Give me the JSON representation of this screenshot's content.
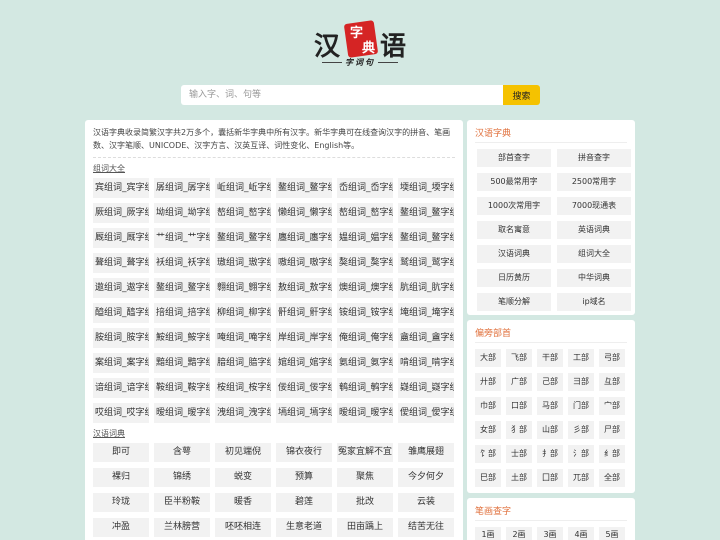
{
  "logo": {
    "char1": "汉",
    "seal1": "字",
    "seal2": "典",
    "char3": "语",
    "tagline": "字词句"
  },
  "search": {
    "placeholder": "输入字、词、句等",
    "button": "搜索",
    "accent": "#f5c200"
  },
  "main": {
    "intro": "汉语字典收录简繁汉字共2万多个，囊括新华字典中所有汉字。新华字典可在线查询汉字的拼音、笔画数、汉字笔顺、UNICODE、汉字方言、汉英互译、词性变化、English等。",
    "zuci_title": "组词大全",
    "zuci": [
      "宾组词_宾字组",
      "孱组词_孱字组",
      "岴组词_岴字组",
      "鳌组词_鳌字组",
      "岙组词_岙字组",
      "堧组词_堧字组",
      "厥组词_厥字组",
      "坳组词_坳字组",
      "嶅组词_嶅字组",
      "懒组词_懒字组",
      "嶅组词_嶅字组",
      "鳌组词_鳌字组",
      "厩组词_厩字组",
      "艹组词_艹字组",
      "鳌组词_鳌字组",
      "廛组词_廛字组",
      "媪组词_媪字组",
      "鳌组词_鳌字组",
      "聱组词_聱字组",
      "袄组词_袄字组",
      "璈组词_璈字组",
      "嗷组词_嗷字组",
      "獒组词_獒字组",
      "鹫组词_鹫字组",
      "遨组词_遨字组",
      "鳌组词_鳌字组",
      "翱组词_翱字组",
      "敖组词_敖字组",
      "燠组词_燠字组",
      "肮组词_肮字组",
      "醯组词_醯字组",
      "掊组词_掊字组",
      "柳组词_柳字组",
      "骭组词_骭字组",
      "铵组词_铵字组",
      "埯组词_埯字组",
      "胺组词_胺字组",
      "鮟组词_鮟字组",
      "唵组词_唵字组",
      "岸组词_岸字组",
      "俺组词_俺字组",
      "盦组词_盦字组",
      "案组词_案字组",
      "黯组词_黯字组",
      "腤组词_腤字组",
      "婠组词_婠字组",
      "氨组词_氨字组",
      "啃组词_啃字组",
      "谙组词_谙字组",
      "鞍组词_鞍字组",
      "桉组词_桉字组",
      "佞组词_佞字组",
      "鹌组词_鹌字组",
      "嶷组词_嶷字组",
      "哎组词_哎字组",
      "暧组词_暧字组",
      "洩组词_洩字组",
      "墕组词_墕字组",
      "暧组词_暧字组",
      "僾组词_僾字组"
    ],
    "cidian_title": "汉语词典",
    "cidian": [
      "即可",
      "含萼",
      "初见端倪",
      "锦衣夜行",
      "冤家宜解不宜",
      "雏鹰展翅",
      "裸归",
      "锦绣",
      "蜕变",
      "预算",
      "聚焦",
      "今夕何夕",
      "玲珑",
      "臣半粉鞍",
      "暖香",
      "碧莲",
      "批改",
      "云装",
      "冲盈",
      "兰林膀营",
      "呸呸相连",
      "生意老道",
      "田亩踽上",
      "结苦无往"
    ]
  },
  "sidebar": {
    "dict_title": "汉语字典",
    "dict_links": [
      "部首查字",
      "拼音查字",
      "500最常用字",
      "2500常用字",
      "1000次常用字",
      "7000现通表",
      "取名寓意",
      "英语词典",
      "汉语词典",
      "组词大全",
      "日历黄历",
      "中华词典",
      "笔顺分解",
      "ip域名"
    ],
    "radical_title": "偏旁部首",
    "radicals": [
      "大部",
      "飞部",
      "干部",
      "工部",
      "弓部",
      "廾部",
      "广部",
      "己部",
      "彐部",
      "彑部",
      "巾部",
      "口部",
      "马部",
      "门部",
      "宀部",
      "女部",
      "犭部",
      "山部",
      "彡部",
      "尸部",
      "饣部",
      "士部",
      "扌部",
      "氵部",
      "纟部",
      "巳部",
      "土部",
      "囗部",
      "兀部",
      "全部"
    ],
    "stroke_title": "笔画查字",
    "strokes": [
      "1画",
      "2画",
      "3画",
      "4画",
      "5画"
    ],
    "title_color": "#e0703c"
  }
}
